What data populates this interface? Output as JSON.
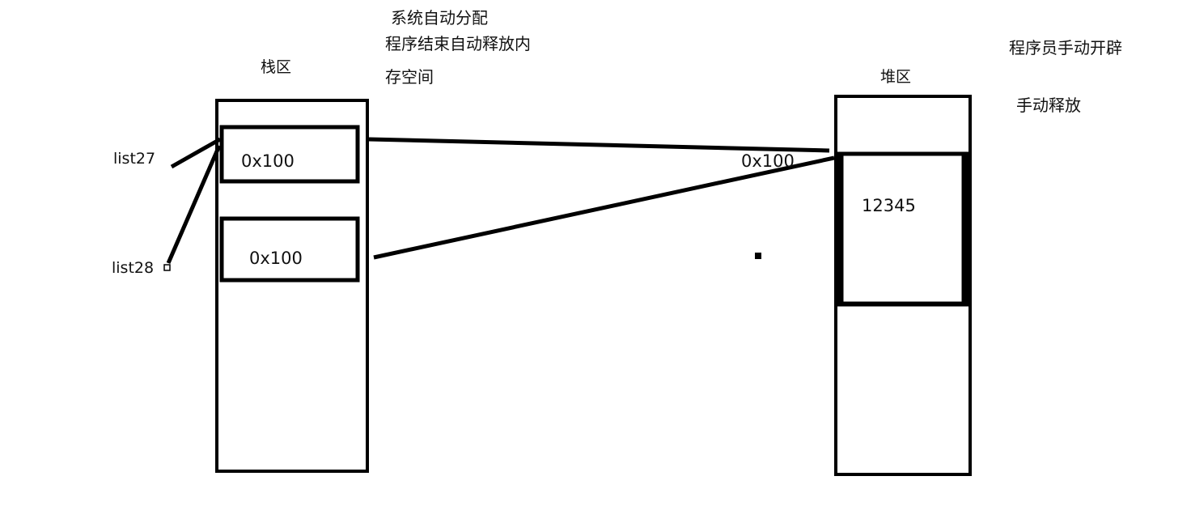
{
  "stack": {
    "title": "栈区",
    "notes": [
      "系统自动分配",
      "程序结束自动释放内",
      "存空间"
    ],
    "cells": [
      {
        "variable": "list27",
        "value": "0x100"
      },
      {
        "variable": "list28",
        "value": "0x100"
      }
    ]
  },
  "heap": {
    "title": "堆区",
    "notes": [
      "程序员手动开辟",
      "手动释放"
    ],
    "address": "0x100",
    "value": "12345"
  },
  "colors": {
    "stroke": "#000000",
    "text": "#111111",
    "background": "#ffffff"
  }
}
